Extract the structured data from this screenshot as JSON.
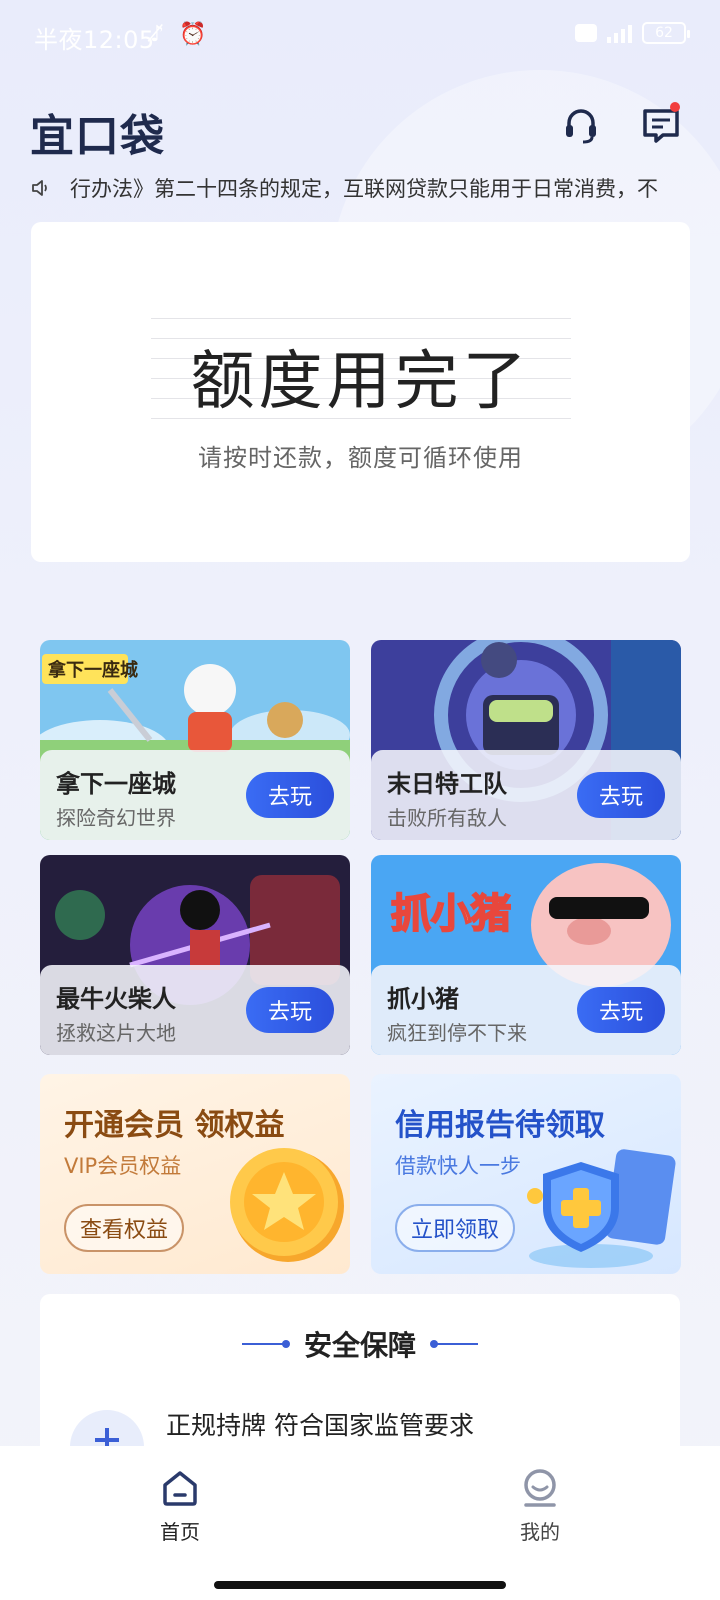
{
  "status_bar": {
    "time": "半夜12:05",
    "battery": "62"
  },
  "header": {
    "logo": "宜口袋"
  },
  "notice": {
    "text": "行办法》第二十四条的规定，互联网贷款只能用于日常消费，不"
  },
  "limit_card": {
    "title": "额度用完了",
    "subtitle": "请按时还款，额度可循环使用"
  },
  "games": [
    {
      "name": "拿下一座城",
      "desc": "探险奇幻世界",
      "button": "去玩",
      "art_label": "拿下一座城"
    },
    {
      "name": "末日特工队",
      "desc": "击败所有敌人",
      "button": "去玩"
    },
    {
      "name": "最牛火柴人",
      "desc": "拯救这片大地",
      "button": "去玩"
    },
    {
      "name": "抓小猪",
      "desc": "疯狂到停不下来",
      "button": "去玩",
      "art_label": "抓小猪"
    }
  ],
  "promos": {
    "vip": {
      "title": "开通会员 领权益",
      "subtitle": "VIP会员权益",
      "button": "查看权益"
    },
    "credit": {
      "title": "信用报告待领取",
      "subtitle": "借款快人一步",
      "button": "立即领取"
    }
  },
  "security": {
    "title": "安全保障",
    "item": "正规持牌 符合国家监管要求"
  },
  "tab_bar": {
    "home": "首页",
    "mine": "我的"
  }
}
